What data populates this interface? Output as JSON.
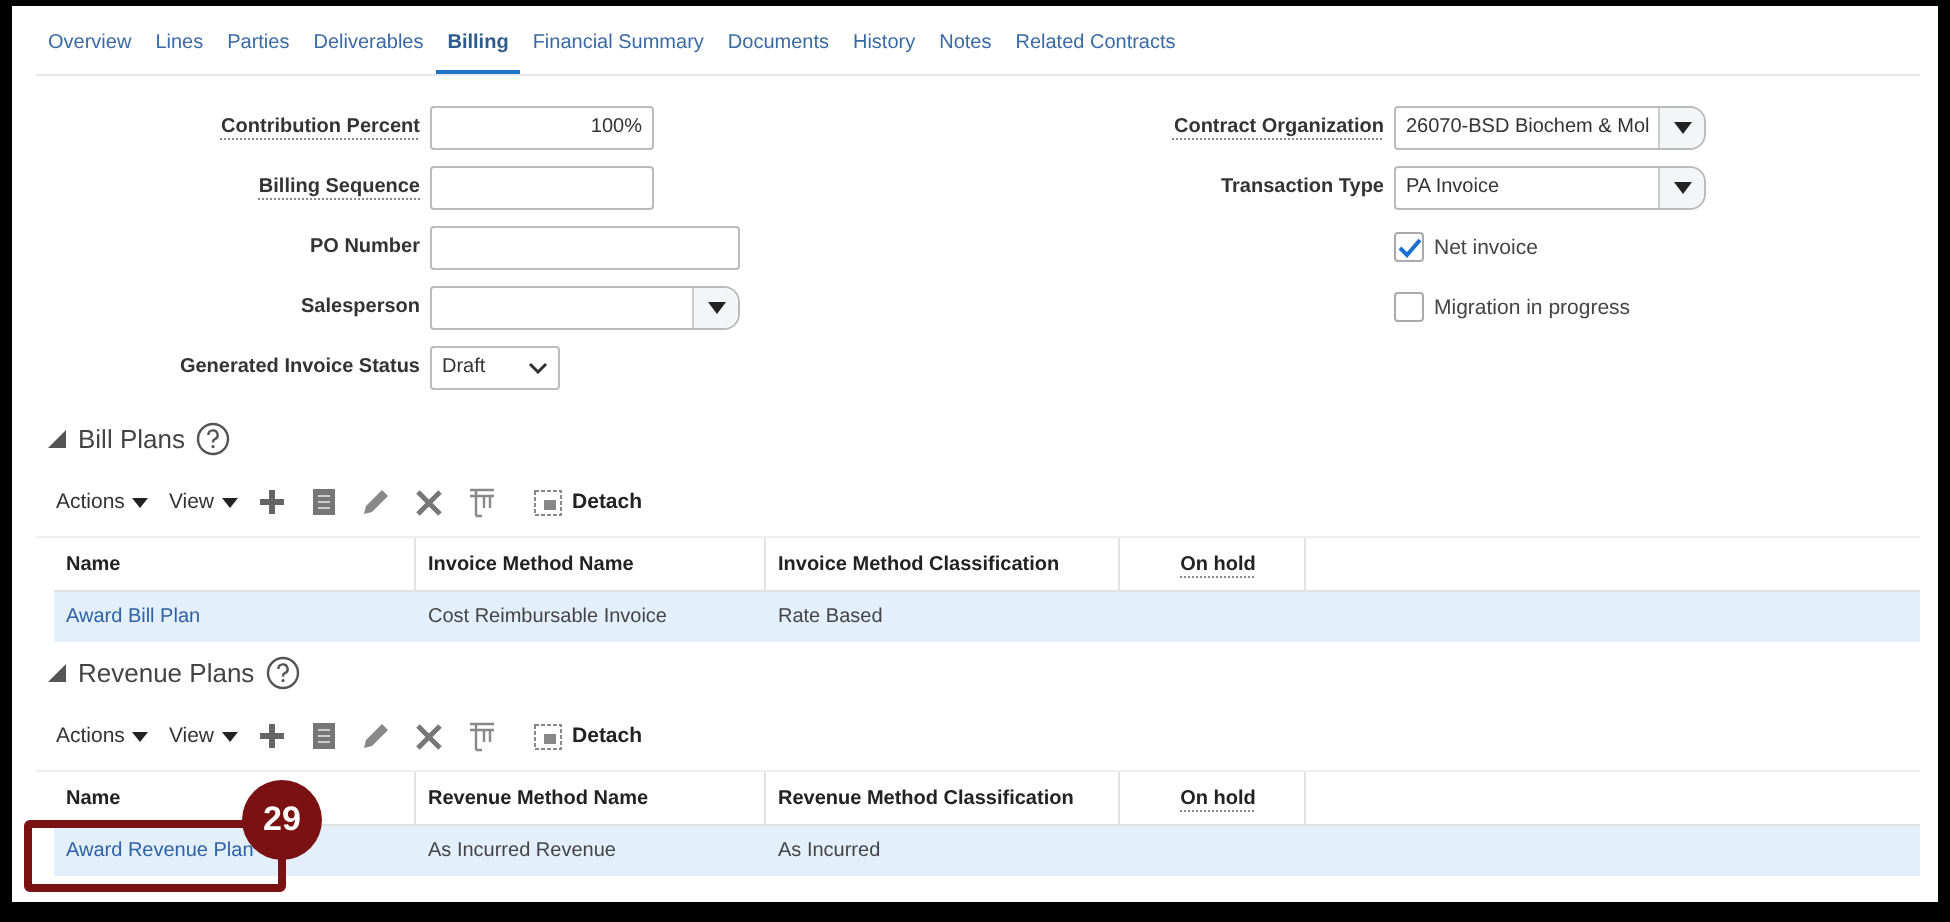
{
  "tabs": [
    {
      "label": "Overview",
      "selected": false
    },
    {
      "label": "Lines",
      "selected": false
    },
    {
      "label": "Parties",
      "selected": false
    },
    {
      "label": "Deliverables",
      "selected": false
    },
    {
      "label": "Billing",
      "selected": true
    },
    {
      "label": "Financial Summary",
      "selected": false
    },
    {
      "label": "Documents",
      "selected": false
    },
    {
      "label": "History",
      "selected": false
    },
    {
      "label": "Notes",
      "selected": false
    },
    {
      "label": "Related Contracts",
      "selected": false
    }
  ],
  "left_fields": [
    {
      "label": "Contribution Percent",
      "hint": true,
      "kind": "text",
      "value": "100%"
    },
    {
      "label": "Billing Sequence",
      "hint": true,
      "kind": "text"
    },
    {
      "label": "PO Number",
      "hint": false,
      "kind": "text"
    },
    {
      "label": "Salesperson",
      "hint": false,
      "kind": "combo"
    },
    {
      "label": "Generated Invoice Status",
      "hint": false,
      "kind": "select",
      "value": "Draft"
    }
  ],
  "right_fields": [
    {
      "label": "Contract Organization",
      "hint": true,
      "kind": "combo",
      "value": "26070-BSD Biochem & Mol"
    },
    {
      "label": "Transaction Type",
      "hint": false,
      "kind": "combo",
      "value": "PA Invoice"
    }
  ],
  "checkboxes": [
    {
      "label": "Net invoice",
      "checked": true
    },
    {
      "label": "Migration in progress",
      "checked": false
    }
  ],
  "sections": [
    {
      "title": "Bill Plans",
      "expanded": true,
      "toolbar": {
        "actions": "Actions",
        "view": "View",
        "detach": "Detach"
      },
      "columns": [
        {
          "label": "Name",
          "hint": false
        },
        {
          "label": "Invoice Method Name",
          "hint": false
        },
        {
          "label": "Invoice Method Classification",
          "hint": false
        },
        {
          "label": "On hold",
          "hint": true
        }
      ],
      "rows": [
        {
          "selected": true,
          "cells": [
            "Award Bill Plan",
            "Cost Reimbursable Invoice",
            "Rate Based"
          ]
        }
      ]
    },
    {
      "title": "Revenue Plans",
      "expanded": true,
      "toolbar": {
        "actions": "Actions",
        "view": "View",
        "detach": "Detach"
      },
      "columns": [
        {
          "label": "Name",
          "hint": false
        },
        {
          "label": "Revenue Method Name",
          "hint": false
        },
        {
          "label": "Revenue Method Classification",
          "hint": false
        },
        {
          "label": "On hold",
          "hint": true
        }
      ],
      "rows": [
        {
          "selected": true,
          "cells": [
            "Award Revenue Plan",
            "As Incurred Revenue",
            "As Incurred"
          ]
        }
      ]
    }
  ],
  "callout": {
    "number": "29"
  }
}
